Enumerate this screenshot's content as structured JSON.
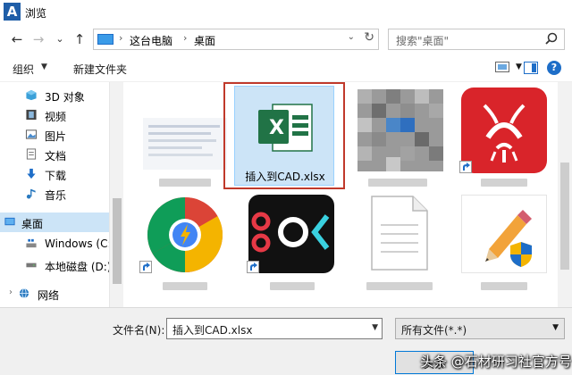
{
  "window": {
    "title": "浏览"
  },
  "nav": {
    "back": "←",
    "forward": "→",
    "recent": "⌄",
    "up": "↑",
    "path": [
      "这台电脑",
      "桌面"
    ],
    "refresh": "↻",
    "search_placeholder": "搜索\"桌面\""
  },
  "toolbar": {
    "organize": "组织",
    "new_folder": "新建文件夹"
  },
  "sidebar": {
    "items": [
      {
        "label": "3D 对象",
        "icon": "cube-icon",
        "color": "#3ba0d8"
      },
      {
        "label": "视频",
        "icon": "film-icon",
        "color": "#444444"
      },
      {
        "label": "图片",
        "icon": "picture-icon",
        "color": "#4a8ccd"
      },
      {
        "label": "文档",
        "icon": "document-icon",
        "color": "#6a6a6a"
      },
      {
        "label": "下载",
        "icon": "download-arrow-icon",
        "color": "#1e6ec8"
      },
      {
        "label": "音乐",
        "icon": "music-note-icon",
        "color": "#2a7ac0"
      },
      {
        "label": "桌面",
        "icon": "desktop-icon",
        "color": "#1e6ec8",
        "selected": true
      },
      {
        "label": "Windows (C:",
        "icon": "windows-drive-icon",
        "color": "#555555"
      },
      {
        "label": "本地磁盘 (D:)",
        "icon": "drive-icon",
        "color": "#555555"
      },
      {
        "label": "网络",
        "icon": "network-icon",
        "color": "#2a7ac0"
      }
    ]
  },
  "files": {
    "selected_name": "插入到CAD.xlsx",
    "excel_letter": "X",
    "colors": {
      "excel_green": "#217346",
      "red_app": "#d9242a",
      "chrome_red": "#db4437",
      "chrome_yellow": "#f4b400",
      "chrome_green": "#0f9d58",
      "chrome_blue": "#4285f4",
      "selection_border": "#c0392b"
    }
  },
  "bottom": {
    "filename_label": "文件名(N):",
    "filename_value": "插入到CAD.xlsx",
    "filetype_value": "所有文件(*.*)",
    "open_label": "头条"
  },
  "watermark": "头条 @石材研习社官方号"
}
